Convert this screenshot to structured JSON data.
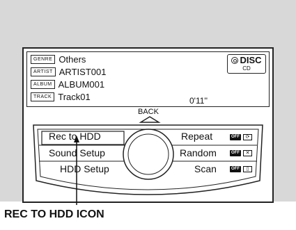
{
  "info": {
    "genre_tag": "GENRE",
    "genre": "Others",
    "artist_tag": "ARTIST",
    "artist": "ARTIST001",
    "album_tag": "ALBUM",
    "album": "ALBUM001",
    "track_tag": "TRACK",
    "track": "Track01",
    "elapsed": "0'11''"
  },
  "source": {
    "label": "DISC",
    "sub": "CD"
  },
  "back_label": "BACK",
  "menu": {
    "left": [
      "Rec to HDD",
      "Sound Setup",
      "HDD Setup"
    ],
    "right": [
      "Repeat",
      "Random",
      "Scan"
    ],
    "right_badge": "OFF",
    "right_icons": [
      "repeat-icon",
      "random-icon",
      "scan-icon"
    ]
  },
  "caption": "REC TO HDD ICON"
}
